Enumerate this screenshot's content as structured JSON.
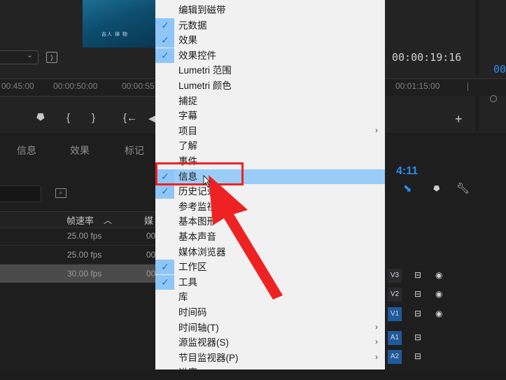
{
  "source_monitor": {
    "thumbnail_text": "吉人 禅 物",
    "settings_glyph": "}",
    "ruler_labels": [
      "00:45:00",
      "00:00:50:00",
      "00:00:55"
    ],
    "controls": [
      "⯂",
      "{",
      "}",
      "{←",
      "◀"
    ]
  },
  "program_monitor": {
    "timecode": "00:00:19:16",
    "timecode2": "00",
    "ruler_label": "00:01:15:00",
    "add_button": "+"
  },
  "project_panel": {
    "tabs": [
      "信息",
      "效果",
      "标记"
    ],
    "columns": {
      "frame_rate": "帧速率",
      "media": "媒"
    },
    "rows": [
      {
        "frame_rate": "25.00 fps",
        "media": "00"
      },
      {
        "frame_rate": "25.00 fps",
        "media": "00"
      },
      {
        "frame_rate": "30.00 fps",
        "media": "00"
      }
    ]
  },
  "timeline": {
    "timecode": "4:11",
    "tracks": [
      {
        "name": "V3",
        "type": "video"
      },
      {
        "name": "V2",
        "type": "video"
      },
      {
        "name": "V1",
        "type": "video"
      },
      {
        "name": "A1",
        "type": "audio"
      },
      {
        "name": "A2",
        "type": "audio"
      }
    ]
  },
  "menu": {
    "items": [
      {
        "label": "编辑到磁带",
        "checked": false
      },
      {
        "label": "元数据",
        "checked": true
      },
      {
        "label": "效果",
        "checked": true
      },
      {
        "label": "效果控件",
        "checked": true
      },
      {
        "label": "Lumetri 范围",
        "checked": false
      },
      {
        "label": "Lumetri 颜色",
        "checked": false
      },
      {
        "label": "捕捉",
        "checked": false
      },
      {
        "label": "字幕",
        "checked": false
      },
      {
        "label": "项目",
        "checked": false,
        "submenu": true
      },
      {
        "label": "了解",
        "checked": false
      },
      {
        "label": "事件",
        "checked": false
      },
      {
        "label": "信息",
        "checked": true,
        "highlighted": true
      },
      {
        "label": "历史记录",
        "checked": true
      },
      {
        "label": "参考监视器",
        "checked": false
      },
      {
        "label": "基本图形",
        "checked": false
      },
      {
        "label": "基本声音",
        "checked": false
      },
      {
        "label": "媒体浏览器",
        "checked": false
      },
      {
        "label": "工作区",
        "checked": true
      },
      {
        "label": "工具",
        "checked": true
      },
      {
        "label": "库",
        "checked": false
      },
      {
        "label": "时间码",
        "checked": false
      },
      {
        "label": "时间轴(T)",
        "checked": false,
        "submenu": true
      },
      {
        "label": "源监视器(S)",
        "checked": false,
        "submenu": true
      },
      {
        "label": "节目监视器(P)",
        "checked": false,
        "submenu": true
      },
      {
        "label": "进度",
        "checked": false
      }
    ]
  },
  "colors": {
    "accent": "#2d8ceb",
    "highlight": "#99cdf8",
    "annotation": "#ee2222"
  }
}
